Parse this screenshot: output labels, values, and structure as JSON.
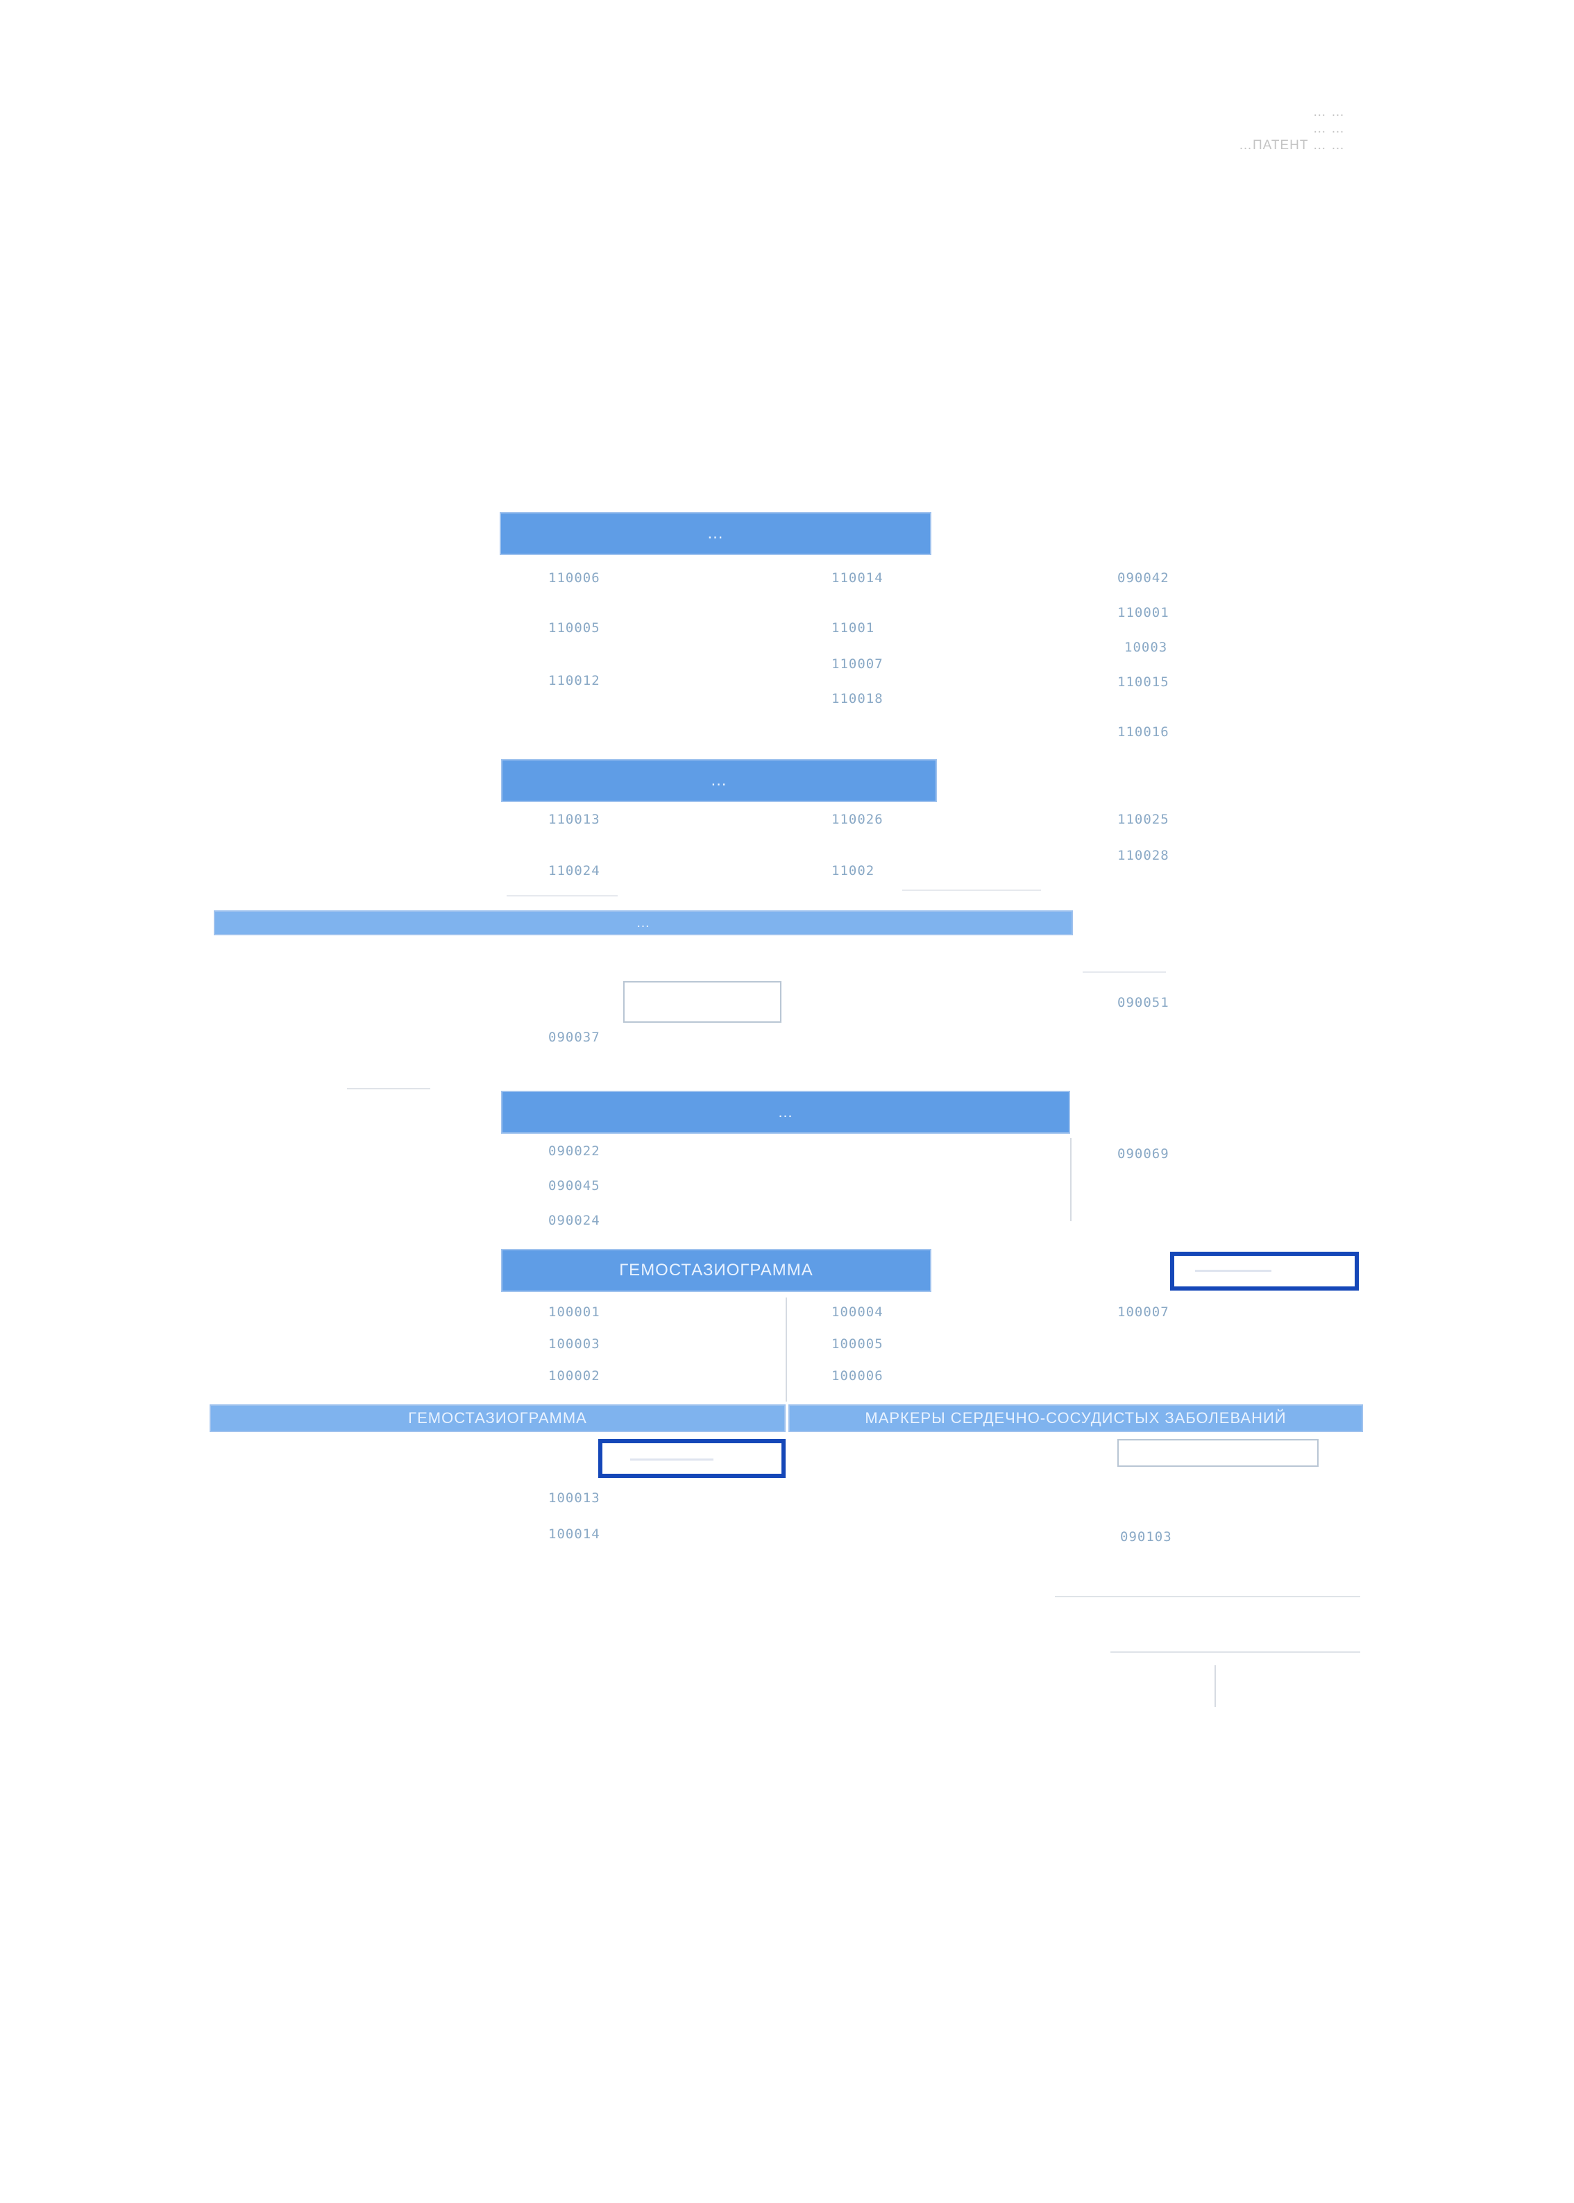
{
  "header": {
    "line1": "… …",
    "line2": "… …",
    "line3": "…ПАТЕНТ … …"
  },
  "sections": {
    "s1": "…",
    "s2": "…",
    "s3": "…",
    "s4": "…",
    "s5": "ГЕМОСТАЗИОГРАММА",
    "s6": "ГЕМОСТАЗИОГРАММА",
    "s7": "МАРКЕРЫ СЕРДЕЧНО-СОСУДИСТЫХ ЗАБОЛЕВАНИЙ"
  },
  "codes": {
    "c1": "110006",
    "c2": "110014",
    "c3": "090042",
    "c4": "110001",
    "c5": "110005",
    "c6": "11001",
    "c7": "10003",
    "c8": "110007",
    "c9": "110012",
    "c10": "110015",
    "c11": "110018",
    "c12": "110016",
    "c13": "110013",
    "c14": "110026",
    "c15": "110025",
    "c16": "110028",
    "c17": "110024",
    "c18": "11002",
    "c19": "090051",
    "c20": "090037",
    "c21": "090022",
    "c22": "090069",
    "c23": "090045",
    "c24": "090024",
    "c25": "100001",
    "c26": "100004",
    "c27": "100007",
    "c28": "100003",
    "c29": "100005",
    "c30": "100002",
    "c31": "100006",
    "c32": "100013",
    "c33": "100014",
    "c34": "090103"
  },
  "colors": {
    "section_blue": "#5f9de6",
    "mark_blue": "#1547b8",
    "code_text": "#8aa9c6"
  }
}
